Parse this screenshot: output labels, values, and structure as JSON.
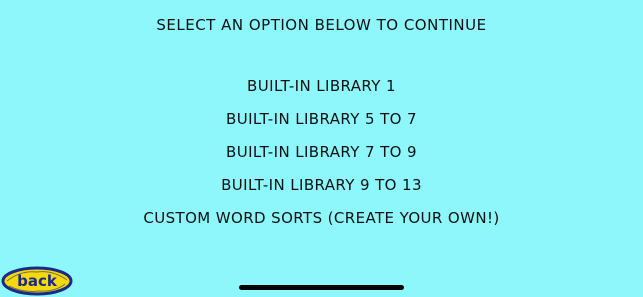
{
  "heading": "SELECT AN OPTION BELOW TO CONTINUE",
  "menu": {
    "items": [
      {
        "label": "BUILT-IN LIBRARY 1"
      },
      {
        "label": "BUILT-IN LIBRARY 5 TO 7"
      },
      {
        "label": "BUILT-IN LIBRARY 7 TO 9"
      },
      {
        "label": "BUILT-IN LIBRARY 9 TO 13"
      },
      {
        "label": "CUSTOM WORD SORTS (CREATE YOUR OWN!)"
      }
    ]
  },
  "back_button": {
    "label": "back",
    "icon": "back-logo-icon"
  },
  "colors": {
    "background": "#8ef7fb",
    "text": "#111111",
    "back_fill": "#f5d90a",
    "back_outline": "#1a2a8a"
  }
}
